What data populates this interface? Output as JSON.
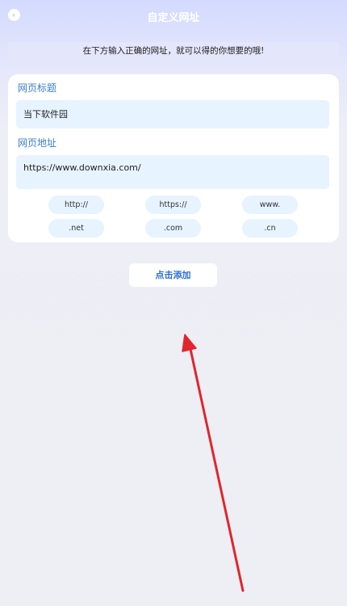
{
  "header": {
    "title": "自定义网址",
    "back_glyph": "‹"
  },
  "notice": "在下方输入正确的网址，就可以得的你想要的哦!",
  "form": {
    "title_label": "网页标题",
    "title_value": "当下软件园",
    "url_label": "网页地址",
    "url_value": "https://www.downxia.com/"
  },
  "chips": [
    "http://",
    "https://",
    "www.",
    ".net",
    ".com",
    ".cn"
  ],
  "add_button": "点击添加",
  "colors": {
    "accent": "#3a7fd0",
    "button_text": "#2f6fd6",
    "field_bg": "#e7f3ff",
    "arrow": "#e0262c"
  },
  "icons": {
    "back": "back-arrow-icon"
  }
}
